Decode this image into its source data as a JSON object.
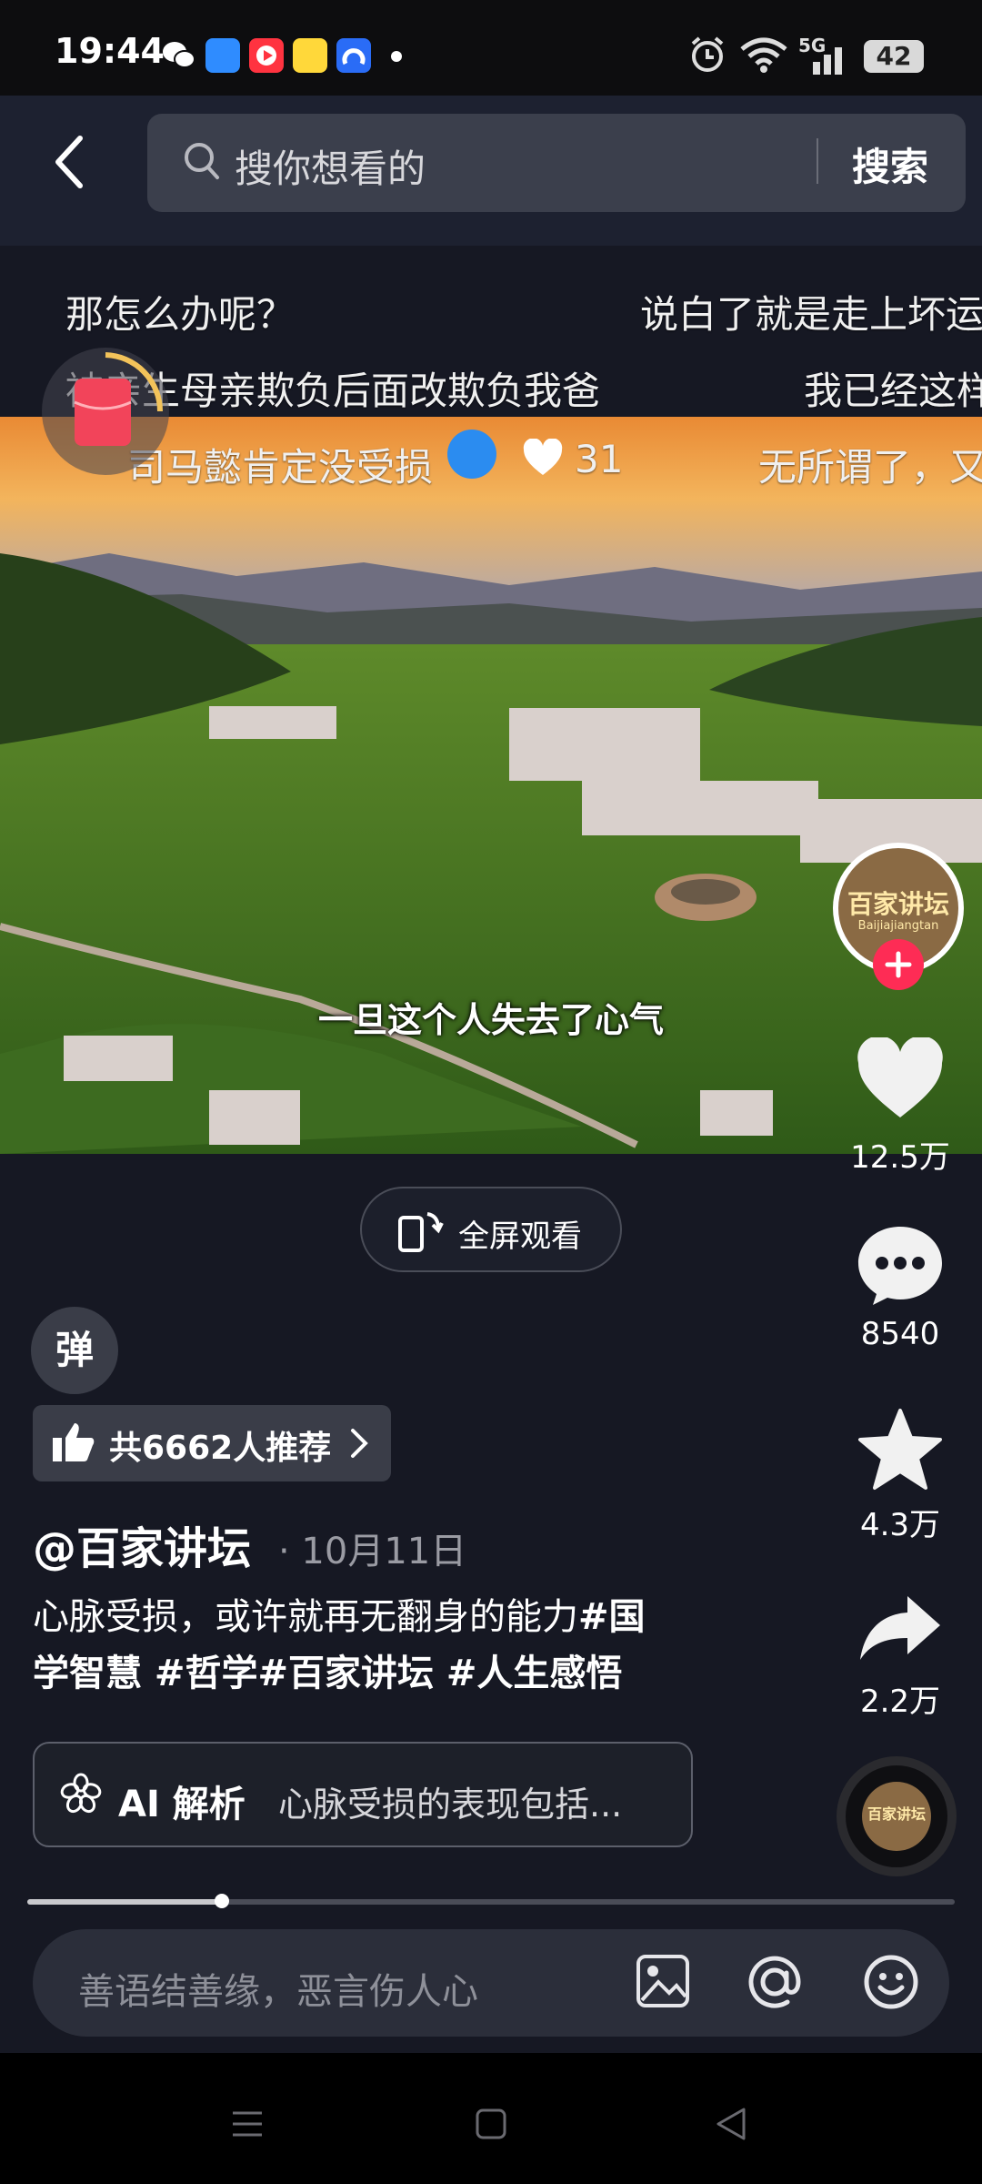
{
  "status_bar": {
    "time": "19:44",
    "battery": "42",
    "network": "5G",
    "icons": [
      "wechat-icon",
      "browser-icon",
      "video-app-icon",
      "game-app-icon",
      "map-app-icon",
      "dot-icon",
      "alarm-icon",
      "wifi-icon",
      "signal-icon",
      "battery-icon"
    ]
  },
  "search": {
    "placeholder": "搜你想看的",
    "button_label": "搜索"
  },
  "danmaku": [
    "那怎么办呢？",
    "说白了就是走上坏运",
    "被亲生母亲欺负后面改欺负我爸",
    "我已经这样",
    "司马懿肯定没受损",
    "无所谓了，又"
  ],
  "danmaku_like_count": "31",
  "video": {
    "subtitle": "一旦这个人失去了心气"
  },
  "creator": {
    "avatar_text": "百家讲坛",
    "avatar_subtext": "Baijiajiangtan"
  },
  "actions": {
    "likes": "12.5万",
    "comments": "8540",
    "favorites": "4.3万",
    "shares": "2.2万"
  },
  "fullscreen_label": "全屏观看",
  "danmu_toggle_label": "弹",
  "recommend_label": "共6662人推荐",
  "post": {
    "author": "@百家讲坛",
    "date": "· 10月11日",
    "description": "心脉受损，或许就再无翻身的能力",
    "hashtags_line1": "#国",
    "hashtags_line2": "学智慧 #哲学#百家讲坛 #人生感悟"
  },
  "ai": {
    "title": "AI 解析",
    "summary": "心脉受损的表现包括..."
  },
  "playback_progress": 0.21,
  "comment": {
    "placeholder": "善语结善缘，恶言伤人心"
  },
  "colors": {
    "background": "#161823",
    "accent": "#fe2c55",
    "sky": "#f0a040"
  }
}
